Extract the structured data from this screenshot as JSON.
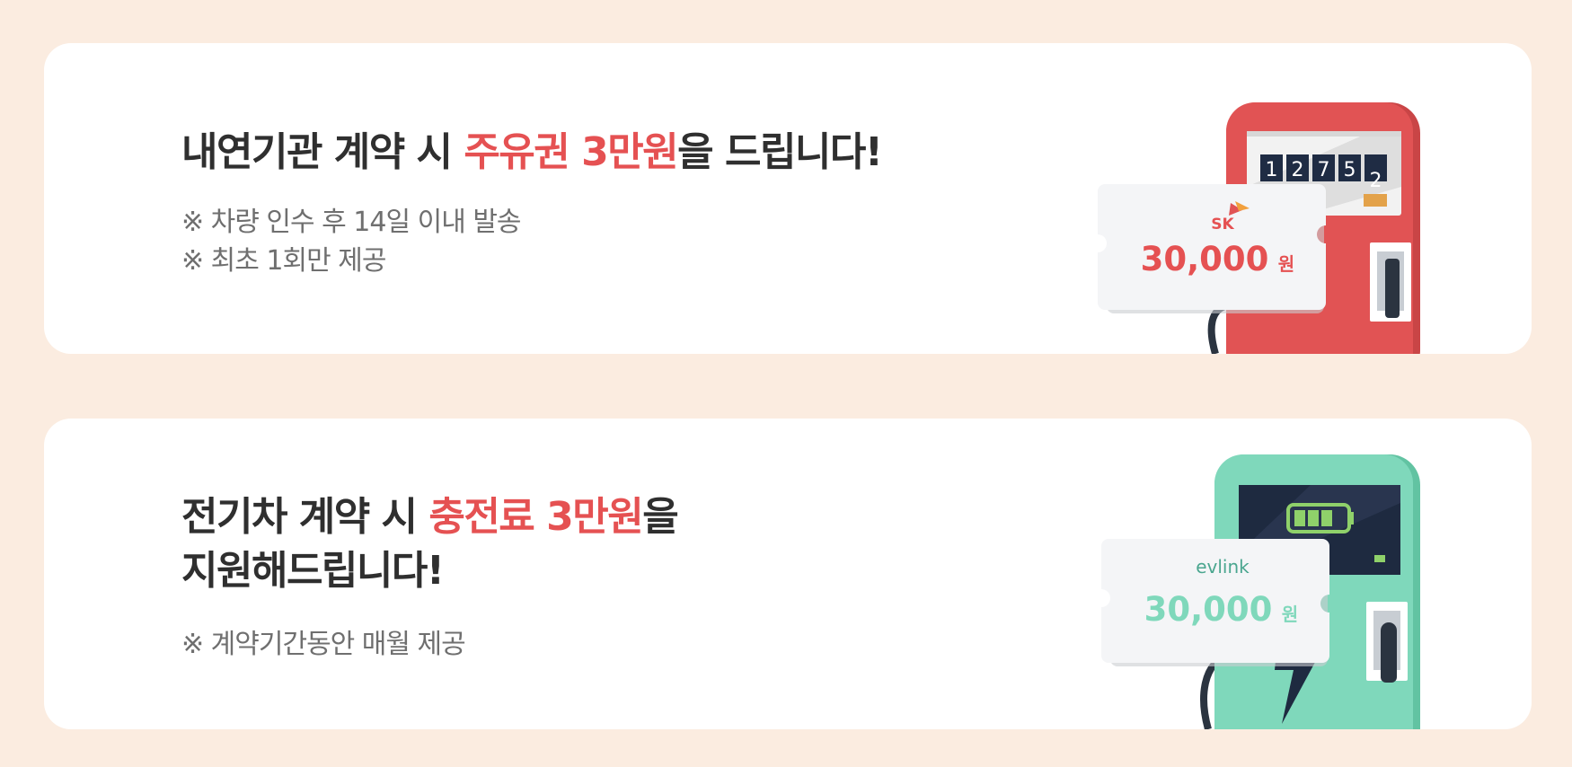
{
  "cards": [
    {
      "headline_pre": "내연기관 계약 시 ",
      "headline_highlight": "주유권 3만원",
      "headline_post": "을 드립니다!",
      "notes": [
        "※ 차량 인수 후 14일 이내 발송",
        "※ 최초 1회만 제공"
      ],
      "illustration": {
        "type": "fuel-pump",
        "body_color": "#e15354",
        "meter_digits": [
          "1",
          "2",
          "7",
          "5",
          "2"
        ],
        "ticket_brand": "SK",
        "ticket_amount": "30,000",
        "ticket_unit": "원",
        "amount_color": "#e55152"
      }
    },
    {
      "headline_pre": "전기차 계약 시 ",
      "headline_highlight": "충전료 3만원",
      "headline_post": "을",
      "headline_line2": "지원해드립니다!",
      "notes": [
        "※ 계약기간동안 매월 제공"
      ],
      "illustration": {
        "type": "ev-charger",
        "body_color": "#7fd8bb",
        "ticket_brand": "evlink",
        "ticket_amount": "30,000",
        "ticket_unit": "원",
        "amount_color": "#7fd8bb"
      }
    }
  ],
  "colors": {
    "background": "#fbece0",
    "highlight": "#e55152",
    "text": "#2f2f2f",
    "note_text": "#6f6f6f"
  }
}
